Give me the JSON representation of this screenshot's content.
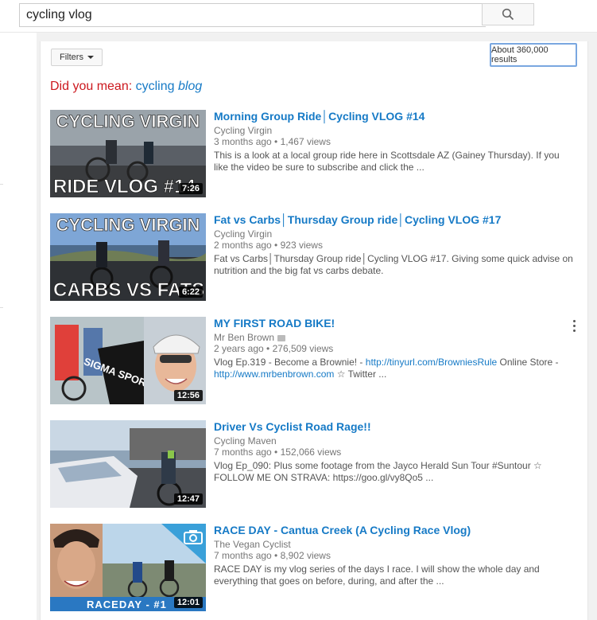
{
  "search": {
    "query": "cycling vlog"
  },
  "toolbar": {
    "filters_label": "Filters",
    "results_count": "About 360,000 results"
  },
  "suggestion": {
    "label": "Did you mean:",
    "plain": "cycling",
    "italic": "blog"
  },
  "colors": {
    "link": "#167ac6",
    "red": "#cc181e",
    "meta": "#767676"
  },
  "results": [
    {
      "title": "Morning Group Ride│Cycling VLOG #14",
      "channel": "Cycling Virgin",
      "age": "3 months ago",
      "views": "1,467 views",
      "desc1": "This is a look at a local group ride here in Scottsdale AZ (Gainey Thursday). If you like the video be sure to subscribe and click the ...",
      "duration": "7:26",
      "thumb_top": "CYCLING VIRGIN",
      "thumb_bottom": "RIDE VLOG #14"
    },
    {
      "title": "Fat vs Carbs│Thursday Group ride│Cycling VLOG #17",
      "channel": "Cycling Virgin",
      "age": "2 months ago",
      "views": "923 views",
      "desc1": "Fat vs Carbs│Thursday Group ride│Cycling VLOG #17. Giving some quick advise on nutrition and the big fat vs carbs debate.",
      "duration": "6:22",
      "thumb_top": "CYCLING VIRGIN",
      "thumb_bottom": "CARBS VS FATS"
    },
    {
      "title": "MY FIRST ROAD BIKE!",
      "channel": "Mr Ben Brown",
      "age": "2 years ago",
      "views": "276,509 views",
      "desc_prefix": "Vlog Ep.319 - Become a Brownie! - ",
      "desc_link1": "http://tinyurl.com/BrowniesRule",
      "desc_mid": " Online Store - ",
      "desc_link2": "http://www.mrbenbrown.com",
      "desc_suffix": " ☆ Twitter ...",
      "duration": "12:56",
      "thumb_sign": "SIGMA SPORT"
    },
    {
      "title": "Driver Vs Cyclist Road Rage!!",
      "channel": "Cycling Maven",
      "age": "7 months ago",
      "views": "152,066 views",
      "desc1": "Vlog Ep_090: Plus some footage from the Jayco Herald Sun Tour #Suntour ☆ FOLLOW ME ON STRAVA: https://goo.gl/vy8Qo5 ...",
      "duration": "12:47"
    },
    {
      "title": "RACE DAY - Cantua Creek (A Cycling Race Vlog)",
      "channel": "The Vegan Cyclist",
      "age": "7 months ago",
      "views": "8,902 views",
      "desc1": "RACE DAY is my vlog series of the days I race. I will show the whole day and everything that goes on before, during, and after the ...",
      "duration": "12:01",
      "thumb_banner": "RACEDAY - #1"
    }
  ],
  "icons": {
    "search": "search-icon",
    "menu": "more-vert-icon",
    "camera": "camera-icon",
    "verified": "verified-badge-icon"
  }
}
